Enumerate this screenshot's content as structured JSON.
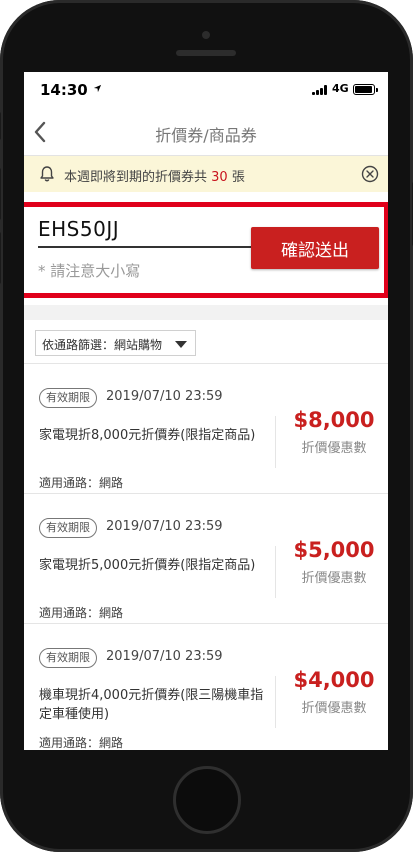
{
  "status_bar": {
    "time": "14:30",
    "network": "4G"
  },
  "nav": {
    "title": "折價券/商品券"
  },
  "notice": {
    "prefix": "本週即將到期的折價券共",
    "count": "30",
    "suffix": "張"
  },
  "code_entry": {
    "value": "EHS50JJ",
    "hint": "* 請注意大小寫",
    "submit_label": "確認送出"
  },
  "filter": {
    "label": "依通路篩選：網站購物"
  },
  "coupons": [
    {
      "tag": "有效期限",
      "date": "2019/07/10 23:59",
      "name": "家電現折8,000元折價券(限指定商品)",
      "channel": "適用通路：網路",
      "amount": "$8,000",
      "amount_label": "折價優惠數"
    },
    {
      "tag": "有效期限",
      "date": "2019/07/10 23:59",
      "name": "家電現折5,000元折價券(限指定商品)",
      "channel": "適用通路：網路",
      "amount": "$5,000",
      "amount_label": "折價優惠數"
    },
    {
      "tag": "有效期限",
      "date": "2019/07/10 23:59",
      "name": "機車現折4,000元折價券(限三陽機車指定車種使用)",
      "channel": "適用通路：網路",
      "amount": "$4,000",
      "amount_label": "折價優惠數"
    }
  ],
  "colors": {
    "accent": "#c9201f",
    "highlight_frame": "#e0001b",
    "notice_bg": "#fbf6d8"
  },
  "icons": {
    "back": "chevron-left-icon",
    "bell": "bell-icon",
    "close": "circle-x-icon",
    "filter": "caret-down-icon"
  }
}
